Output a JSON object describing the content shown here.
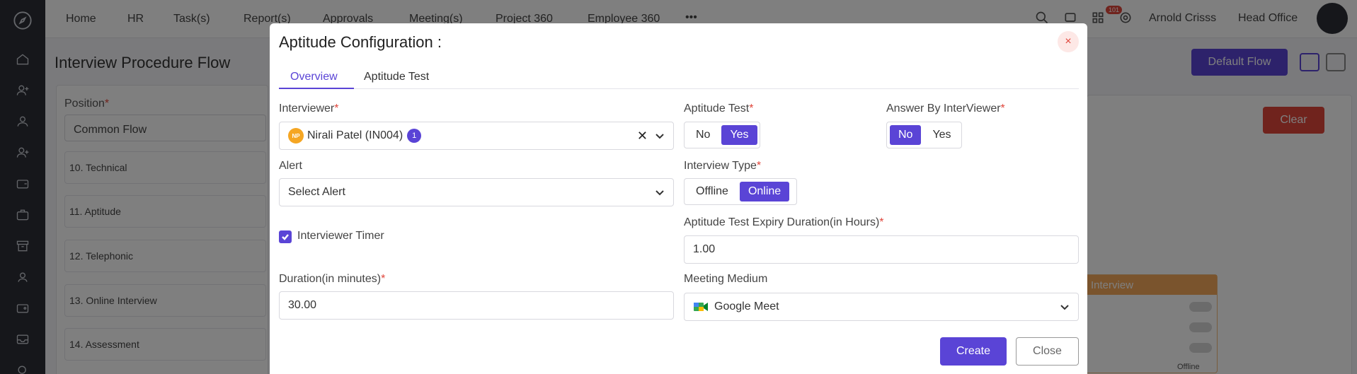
{
  "topbar": {
    "nav": [
      "Home",
      "HR",
      "Task(s)",
      "Report(s)",
      "Approvals",
      "Meeting(s)",
      "Project 360",
      "Employee 360"
    ],
    "more": "•••",
    "notification_count": "101",
    "user_name": "Arnold Crisss",
    "office": "Head Office"
  },
  "background": {
    "page_title": "Interview Procedure Flow",
    "default_flow_label": "Default Flow",
    "position_label": "Position",
    "position_value": "Common Flow",
    "steps": [
      "10. Technical",
      "11. Aptitude",
      "12. Telephonic",
      "13. Online Interview",
      "14. Assessment"
    ],
    "clear_label": "Clear",
    "interview_card_title": "Interview",
    "offline_label": "Offline"
  },
  "modal": {
    "title": "Aptitude Configuration :",
    "close_icon": "×",
    "tabs": [
      "Overview",
      "Aptitude Test"
    ],
    "interviewer": {
      "label": "Interviewer",
      "initials": "NP",
      "value": "Nirali Patel (IN004)",
      "count": "1"
    },
    "aptitude_test": {
      "label": "Aptitude Test",
      "options": [
        "No",
        "Yes"
      ],
      "selected": "Yes"
    },
    "answer_by_interviewer": {
      "label": "Answer By InterViewer",
      "options": [
        "No",
        "Yes"
      ],
      "selected": "No"
    },
    "alert": {
      "label": "Alert",
      "placeholder": "Select Alert"
    },
    "interview_type": {
      "label": "Interview Type",
      "options": [
        "Offline",
        "Online"
      ],
      "selected": "Online"
    },
    "interviewer_timer": {
      "label": "Interviewer Timer",
      "checked": true
    },
    "expiry_duration": {
      "label": "Aptitude Test Expiry Duration(in Hours)",
      "value": "1.00"
    },
    "duration": {
      "label": "Duration(in minutes)",
      "value": "30.00"
    },
    "meeting_medium": {
      "label": "Meeting Medium",
      "value": "Google Meet"
    },
    "create_label": "Create",
    "close_label": "Close"
  },
  "colors": {
    "accent": "#5a44d6",
    "required": "#e0463b"
  }
}
